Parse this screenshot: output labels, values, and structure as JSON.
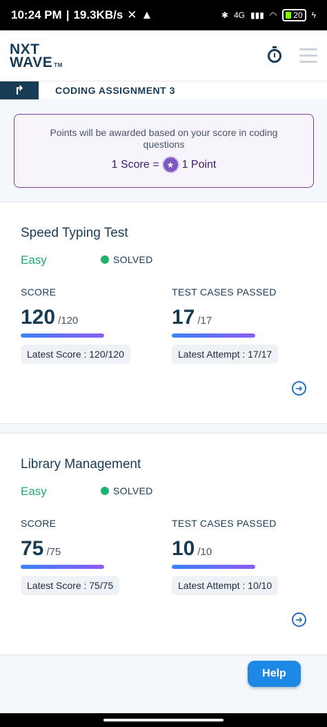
{
  "status_bar": {
    "time": "10:24 PM",
    "speed": "19.3KB/s",
    "network": "4G",
    "battery": "20"
  },
  "header": {
    "logo_line1": "NXT",
    "logo_line2": "WAVE",
    "logo_tm": "TM"
  },
  "sub_header": {
    "title": "CODING ASSIGNMENT 3"
  },
  "info": {
    "text": "Points will be awarded based on your score in coding questions",
    "score_label": "1 Score =",
    "point_label": "1 Point"
  },
  "cards": [
    {
      "title": "Speed Typing Test",
      "difficulty": "Easy",
      "status": "SOLVED",
      "score_label": "SCORE",
      "score": "120",
      "score_total": "/120",
      "score_progress": 1.0,
      "latest_score": "Latest Score : 120/120",
      "tests_label": "TEST CASES PASSED",
      "tests": "17",
      "tests_total": "/17",
      "tests_progress": 1.0,
      "latest_attempt": "Latest Attempt : 17/17"
    },
    {
      "title": "Library Management",
      "difficulty": "Easy",
      "status": "SOLVED",
      "score_label": "SCORE",
      "score": "75",
      "score_total": "/75",
      "score_progress": 1.0,
      "latest_score": "Latest Score : 75/75",
      "tests_label": "TEST CASES PASSED",
      "tests": "10",
      "tests_total": "/10",
      "tests_progress": 1.0,
      "latest_attempt": "Latest Attempt : 10/10"
    }
  ],
  "help": {
    "label": "Help"
  },
  "colors": {
    "brand": "#183b56",
    "easy": "#1ea87a",
    "solved_dot": "#1bb36e",
    "help": "#1e88e5",
    "info_border": "#7b3f96"
  },
  "icons": [
    "timer-icon",
    "menu-icon",
    "back-icon",
    "star-icon",
    "arrow-right-circle-icon",
    "battery-icon"
  ]
}
